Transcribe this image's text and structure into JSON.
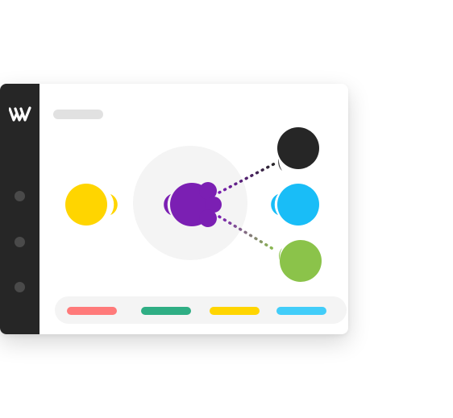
{
  "colors": {
    "sidebar": "#262626",
    "window_bg": "#ffffff",
    "source_node": "#ffd500",
    "hub_node": "#7b1fb3",
    "target_top": "#262626",
    "target_mid": "#19bdf7",
    "target_bottom": "#8bc34a",
    "halo": "#f4f4f4"
  },
  "sidebar": {
    "logo_icon": "w-logo-icon",
    "nav_items": [
      {
        "icon": "nav-dot-icon"
      },
      {
        "icon": "nav-dot-icon"
      },
      {
        "icon": "nav-dot-icon"
      }
    ]
  },
  "header": {
    "title_placeholder": ""
  },
  "bottom_bar": {
    "pills": [
      {
        "color": "#ff7a7a"
      },
      {
        "color": "#2fae84"
      },
      {
        "color": "#ffd500"
      },
      {
        "color": "#42cdf9"
      }
    ]
  }
}
